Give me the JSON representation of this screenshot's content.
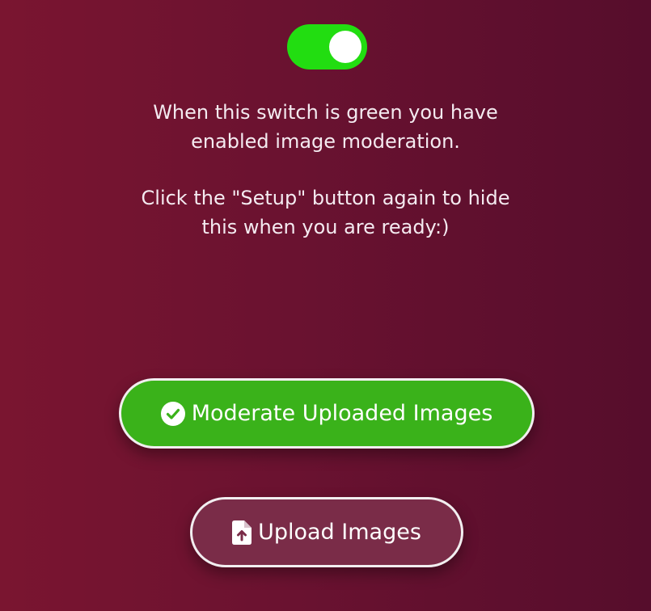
{
  "toggle": {
    "state": "on",
    "color": "#22dd11"
  },
  "info": {
    "paragraph1": "When this switch is green you have enabled image moderation.",
    "paragraph2": "Click the \"Setup\" button again to hide this when you are ready:)"
  },
  "buttons": {
    "moderate_label": "Moderate Uploaded Images",
    "moderate_icon": "check-circle-icon",
    "moderate_color": "#3ab21a",
    "upload_label": "Upload Images",
    "upload_icon": "file-upload-icon",
    "upload_color": "#7a2c48"
  }
}
